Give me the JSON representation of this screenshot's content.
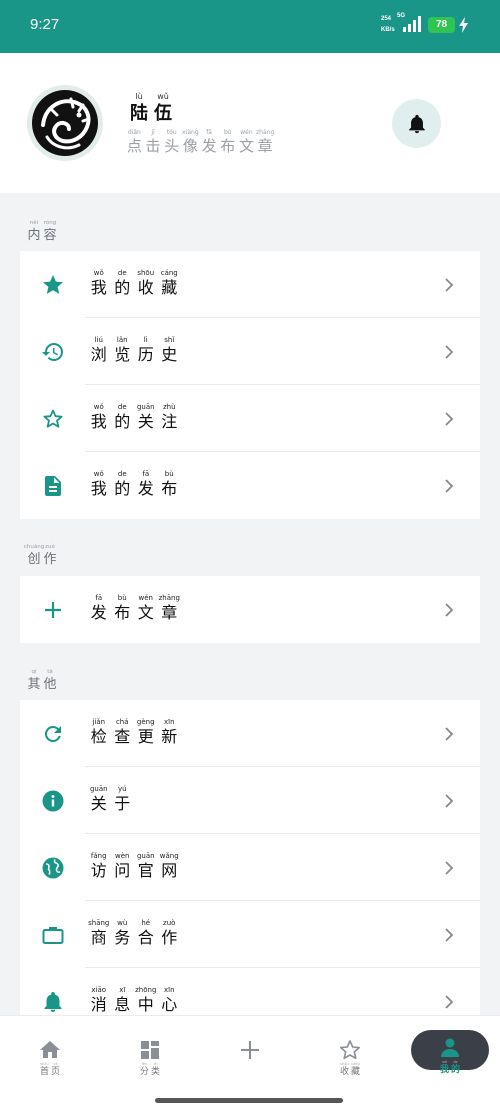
{
  "status": {
    "time": "9:27",
    "net_speed": "254",
    "net_unit": "KB/s",
    "network": "5G",
    "battery": "78"
  },
  "profile": {
    "name": [
      {
        "py": "lù",
        "hz": "陆"
      },
      {
        "py": "wǔ",
        "hz": "伍"
      }
    ],
    "subtitle": [
      {
        "py": "diǎn",
        "hz": "点"
      },
      {
        "py": "jī",
        "hz": "击"
      },
      {
        "py": "tóu",
        "hz": "头"
      },
      {
        "py": "xiàng",
        "hz": "像"
      },
      {
        "py": "fā",
        "hz": "发"
      },
      {
        "py": "bù",
        "hz": "布"
      },
      {
        "py": "wén",
        "hz": "文"
      },
      {
        "py": "zhāng",
        "hz": "章"
      }
    ],
    "avatar_icon": "dragon-logo-icon",
    "bell_icon": "bell-icon"
  },
  "sections": {
    "content": {
      "label": [
        {
          "py": "nèi",
          "hz": "内"
        },
        {
          "py": "róng",
          "hz": "容"
        }
      ],
      "items": [
        {
          "icon": "star-filled-icon",
          "label": [
            {
              "py": "wǒ",
              "hz": "我"
            },
            {
              "py": "de",
              "hz": "的"
            },
            {
              "py": "shōu",
              "hz": "收"
            },
            {
              "py": "cáng",
              "hz": "藏"
            }
          ]
        },
        {
          "icon": "history-icon",
          "label": [
            {
              "py": "liú",
              "hz": "浏"
            },
            {
              "py": "lǎn",
              "hz": "览"
            },
            {
              "py": "lì",
              "hz": "历"
            },
            {
              "py": "shǐ",
              "hz": "史"
            }
          ]
        },
        {
          "icon": "star-outline-icon",
          "label": [
            {
              "py": "wǒ",
              "hz": "我"
            },
            {
              "py": "de",
              "hz": "的"
            },
            {
              "py": "guān",
              "hz": "关"
            },
            {
              "py": "zhù",
              "hz": "注"
            }
          ]
        },
        {
          "icon": "document-icon",
          "label": [
            {
              "py": "wǒ",
              "hz": "我"
            },
            {
              "py": "de",
              "hz": "的"
            },
            {
              "py": "fā",
              "hz": "发"
            },
            {
              "py": "bù",
              "hz": "布"
            }
          ]
        }
      ]
    },
    "create": {
      "label": [
        {
          "py": "chuàng",
          "hz": "创"
        },
        {
          "py": "zuò",
          "hz": "作"
        }
      ],
      "items": [
        {
          "icon": "plus-icon",
          "label": [
            {
              "py": "fā",
              "hz": "发"
            },
            {
              "py": "bù",
              "hz": "布"
            },
            {
              "py": "wén",
              "hz": "文"
            },
            {
              "py": "zhāng",
              "hz": "章"
            }
          ]
        }
      ]
    },
    "other": {
      "label": [
        {
          "py": "qí",
          "hz": "其"
        },
        {
          "py": "tā",
          "hz": "他"
        }
      ],
      "items": [
        {
          "icon": "refresh-icon",
          "label": [
            {
              "py": "jiǎn",
              "hz": "检"
            },
            {
              "py": "chá",
              "hz": "查"
            },
            {
              "py": "gèng",
              "hz": "更"
            },
            {
              "py": "xīn",
              "hz": "新"
            }
          ]
        },
        {
          "icon": "info-icon",
          "label": [
            {
              "py": "guān",
              "hz": "关"
            },
            {
              "py": "yú",
              "hz": "于"
            }
          ]
        },
        {
          "icon": "globe-icon",
          "label": [
            {
              "py": "fǎng",
              "hz": "访"
            },
            {
              "py": "wèn",
              "hz": "问"
            },
            {
              "py": "guān",
              "hz": "官"
            },
            {
              "py": "wǎng",
              "hz": "网"
            }
          ]
        },
        {
          "icon": "briefcase-icon",
          "label": [
            {
              "py": "shāng",
              "hz": "商"
            },
            {
              "py": "wù",
              "hz": "务"
            },
            {
              "py": "hé",
              "hz": "合"
            },
            {
              "py": "zuò",
              "hz": "作"
            }
          ]
        },
        {
          "icon": "bell-icon",
          "label": [
            {
              "py": "xiāo",
              "hz": "消"
            },
            {
              "py": "xī",
              "hz": "息"
            },
            {
              "py": "zhōng",
              "hz": "中"
            },
            {
              "py": "xīn",
              "hz": "心"
            }
          ]
        }
      ]
    }
  },
  "bottom_nav": [
    {
      "icon": "home-icon",
      "label": [
        {
          "py": "shǒu",
          "hz": "首"
        },
        {
          "py": "yè",
          "hz": "页"
        }
      ]
    },
    {
      "icon": "category-icon",
      "label": [
        {
          "py": "fēn",
          "hz": "分"
        },
        {
          "py": "lèi",
          "hz": "类"
        }
      ]
    },
    {
      "icon": "plus-icon",
      "label": []
    },
    {
      "icon": "star-outline-icon",
      "label": [
        {
          "py": "shōu",
          "hz": "收"
        },
        {
          "py": "cáng",
          "hz": "藏"
        }
      ]
    },
    {
      "icon": "user-icon",
      "label": [
        {
          "py": "wǒ",
          "hz": "我"
        },
        {
          "py": "de",
          "hz": "的"
        }
      ],
      "active": true
    }
  ],
  "colors": {
    "accent": "#1a9688",
    "accent_light": "#e0efee",
    "nav_active_bg": "#3b3f47",
    "muted": "#9aa0a6"
  }
}
